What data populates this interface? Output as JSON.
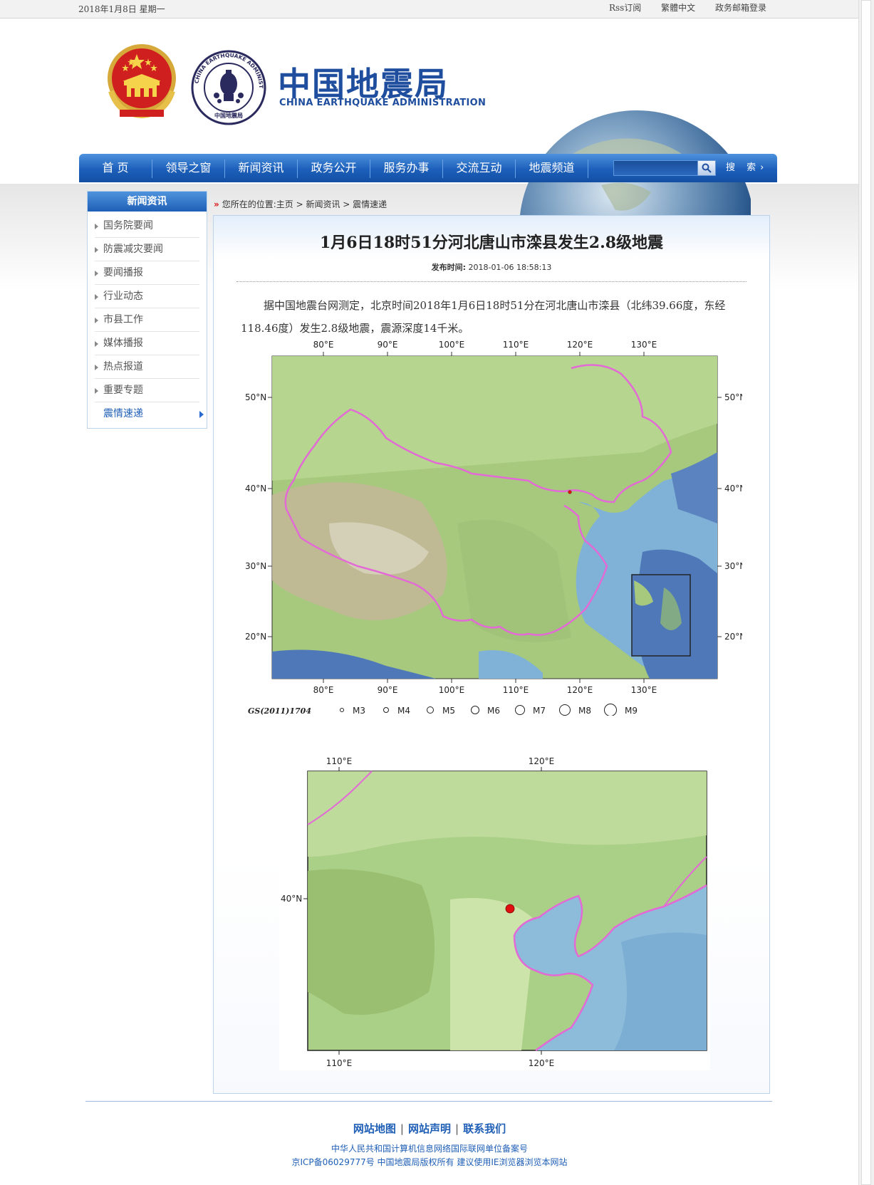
{
  "topbar": {
    "date": "2018年1月8日 星期一",
    "rss": "Rss订阅",
    "traditional": "繁體中文",
    "mail": "政务邮箱登录"
  },
  "header": {
    "title_cn": "中国地震局",
    "title_en": "CHINA EARTHQUAKE ADMINISTRATION",
    "logo_ring_text": "CHINA EARTHQUAKE ADMINISTRATION",
    "logo_bottom_text": "中国地震局"
  },
  "nav": {
    "items": [
      "首 页",
      "领导之窗",
      "新闻资讯",
      "政务公开",
      "服务办事",
      "交流互动",
      "地震频道"
    ],
    "search_label": "搜 索›",
    "search_placeholder": ""
  },
  "sidebar": {
    "title": "新闻资讯",
    "items": [
      "国务院要闻",
      "防震减灾要闻",
      "要闻播报",
      "行业动态",
      "市县工作",
      "媒体播报",
      "热点报道",
      "重要专题",
      "震情速递"
    ],
    "active_index": 8
  },
  "breadcrumb": {
    "mark": "»",
    "text": "您所在的位置:主页 > 新闻资讯 > 震情速递"
  },
  "article": {
    "title": "1月6日18时51分河北唐山市滦县发生2.8级地震",
    "pubtime_label": "发布时间:",
    "pubtime": "2018-01-06 18:58:13",
    "body": "据中国地震台网测定，北京时间2018年1月6日18时51分在河北唐山市滦县（北纬39.66度，东经118.46度）发生2.8级地震，震源深度14千米。"
  },
  "map1": {
    "lon_labels": [
      "80°E",
      "90°E",
      "100°E",
      "110°E",
      "120°E",
      "130°E"
    ],
    "lat_labels": [
      "50°N",
      "40°N",
      "30°N",
      "20°N"
    ],
    "code": "GS(2011)1704",
    "legend": [
      "M3",
      "M4",
      "M5",
      "M6",
      "M7",
      "M8",
      "M9"
    ]
  },
  "map2": {
    "lon_labels": [
      "110°E",
      "120°E"
    ],
    "lat_labels": [
      "40°N"
    ]
  },
  "epicenter": {
    "lat": 39.66,
    "lon": 118.46
  },
  "footer": {
    "links": [
      "网站地图",
      "网站声明",
      "联系我们"
    ],
    "line1": "中华人民共和国计算机信息网络国际联网单位备案号",
    "line2": "京ICP备06029777号 中国地震局版权所有 建议使用IE浏览器浏览本网站"
  },
  "colors": {
    "nav_blue": "#1c5fba",
    "title_blue": "#1f4e9e",
    "border_pink": "#e36ad6",
    "epicenter_red": "#e01010"
  }
}
